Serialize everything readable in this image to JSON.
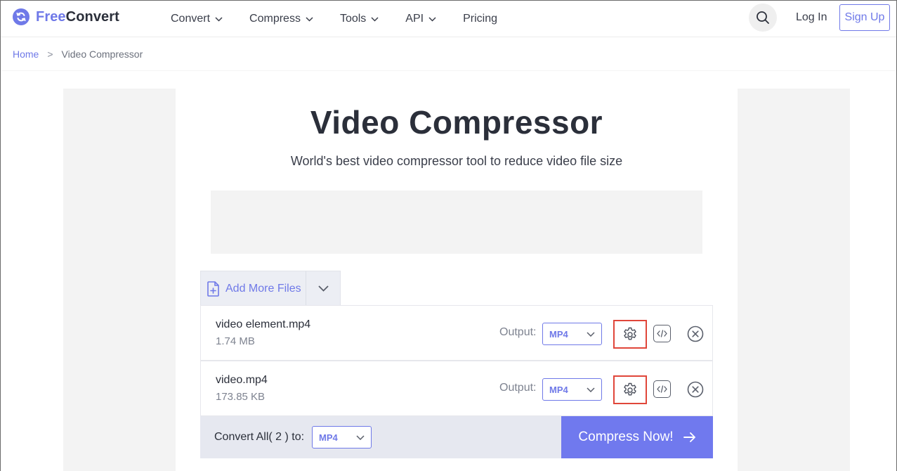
{
  "brand": {
    "free": "Free",
    "convert": "Convert",
    "color": "#6f79e8"
  },
  "nav": {
    "items": [
      {
        "label": "Convert",
        "has_dropdown": true
      },
      {
        "label": "Compress",
        "has_dropdown": true
      },
      {
        "label": "Tools",
        "has_dropdown": true
      },
      {
        "label": "API",
        "has_dropdown": true
      },
      {
        "label": "Pricing",
        "has_dropdown": false
      }
    ],
    "login": "Log In",
    "signup": "Sign Up"
  },
  "breadcrumb": {
    "home": "Home",
    "separator": ">",
    "current": "Video Compressor"
  },
  "hero": {
    "title": "Video Compressor",
    "subtitle": "World's best video compressor tool to reduce video file size"
  },
  "uploader": {
    "add_more_label": "Add More Files",
    "output_label": "Output:",
    "files": [
      {
        "name": "video element.mp4",
        "size": "1.74 MB",
        "format": "MP4"
      },
      {
        "name": "video.mp4",
        "size": "173.85 KB",
        "format": "MP4"
      }
    ],
    "convert_all_label": "Convert All( 2 ) to:",
    "convert_all_format": "MP4",
    "compress_button": "Compress Now!"
  },
  "icons": {
    "logo": "refresh-icon",
    "search": "search-icon",
    "add_file": "file-plus-icon",
    "dropdown": "chevron-down-icon",
    "settings": "gear-icon",
    "embed": "code-icon",
    "remove": "close-circle-icon",
    "submit": "arrow-right-icon"
  },
  "colors": {
    "accent": "#6f79e8",
    "highlight": "#e0463a"
  }
}
